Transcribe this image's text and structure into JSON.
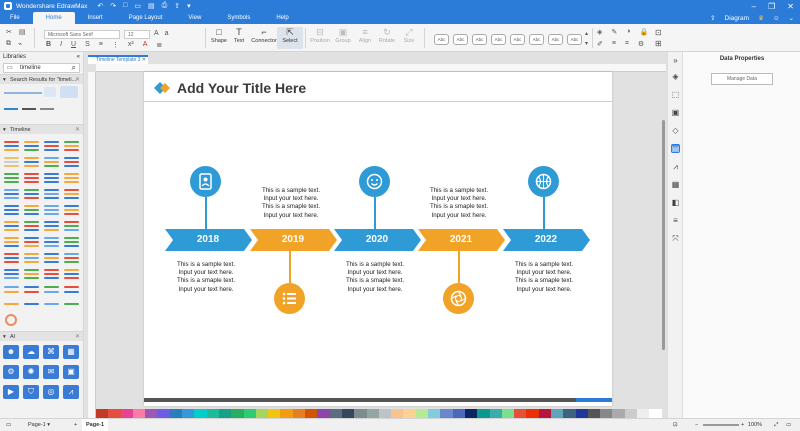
{
  "app": {
    "name": "Wondershare EdrawMax"
  },
  "menu": {
    "tabs": [
      "File",
      "Home",
      "Insert",
      "Page Layout",
      "View",
      "Symbols",
      "Help"
    ],
    "active": "Home",
    "right_label": "Diagram"
  },
  "ribbon": {
    "font_family": "Microsoft Sans Serif",
    "font_size": "12",
    "tools": [
      {
        "label": "Shape",
        "icon": "□"
      },
      {
        "label": "Text",
        "icon": "T"
      },
      {
        "label": "Connector",
        "icon": "⌐"
      },
      {
        "label": "Select",
        "icon": "⇱"
      },
      {
        "label": "Position",
        "icon": "⊟"
      },
      {
        "label": "Group",
        "icon": "▣"
      },
      {
        "label": "Align",
        "icon": "≡"
      },
      {
        "label": "Rotate",
        "icon": "↻"
      },
      {
        "label": "Size",
        "icon": "⤢"
      }
    ],
    "style_swatch_label": "Abc"
  },
  "left_panel": {
    "title": "Libraries",
    "search_value": "timeline",
    "search_results_label": "Search Results for \"timeli...",
    "timeline_section": "Timeline",
    "ai_section": "AI"
  },
  "document": {
    "tab_title": "Timeline Template 3"
  },
  "canvas": {
    "title": "Add Your Title Here",
    "years": [
      "2018",
      "2019",
      "2020",
      "2021",
      "2022"
    ],
    "arrow_colors": [
      "#2e9bd6",
      "#f0a326",
      "#2e9bd6",
      "#f0a326",
      "#2e9bd6"
    ],
    "text_lines": [
      "This is a sample text.",
      "Input your text here.",
      "This is a smaple text.",
      "Input your text here."
    ],
    "icons": [
      "contact-book-icon",
      "list-icon",
      "smile-icon",
      "aperture-icon",
      "basketball-icon"
    ]
  },
  "right_panel": {
    "title": "Data Properties",
    "manage_button": "Manage Data"
  },
  "status": {
    "page_selector": "Page-1",
    "page_tab": "Page-1",
    "zoom": "100%"
  }
}
